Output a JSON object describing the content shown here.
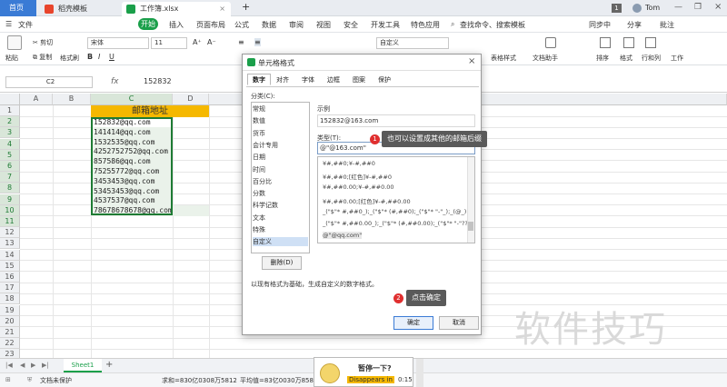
{
  "titlebar": {
    "home": "首页",
    "tab1": "稻壳模板",
    "tab2": "工作簿.xlsx",
    "new_tab": "+",
    "user": "Tom",
    "page_num": "1"
  },
  "menu": {
    "file": "文件",
    "start": "开始",
    "insert": "插入",
    "layout": "页面布局",
    "formula": "公式",
    "data": "数据",
    "review": "审阅",
    "view": "视图",
    "security": "安全",
    "dev": "开发工具",
    "special": "特色应用",
    "search": "查找命令、搜索模板",
    "sync": "同步中",
    "share": "分享",
    "comment": "批注"
  },
  "ribbon": {
    "paste": "粘贴",
    "cut": "剪切",
    "copy": "复制",
    "format_painter": "格式刷",
    "font_name": "宋体",
    "font_size": "11",
    "number_format": "自定义",
    "table_style": "表格样式",
    "doc_helper": "文档助手",
    "sort": "排序",
    "format": "格式",
    "row_col": "行和列",
    "worksheet": "工作"
  },
  "formula_bar": {
    "cell_ref": "C2",
    "fx": "fx",
    "value": "152832"
  },
  "grid": {
    "columns": [
      "A",
      "B",
      "C",
      "D"
    ],
    "rows": [
      "1",
      "2",
      "3",
      "4",
      "5",
      "6",
      "7",
      "8",
      "9",
      "10",
      "11",
      "12",
      "13",
      "14",
      "15",
      "16",
      "17",
      "18",
      "19",
      "20",
      "21",
      "22",
      "23"
    ],
    "header": "邮箱地址",
    "emails": [
      "152832@qq.com",
      "141414@qq.com",
      "1532535@qq.com",
      "4252752752@qq.com",
      "857586@qq.com",
      "75255772@qq.com",
      "3453453@qq.com",
      "53453453@qq.com",
      "4537537@qq.com",
      "78678678678@qq.com"
    ]
  },
  "dialog": {
    "title": "单元格格式",
    "close": "×",
    "tabs": [
      "数字",
      "对齐",
      "字体",
      "边框",
      "图案",
      "保护"
    ],
    "category_label": "分类(C):",
    "categories": [
      "常规",
      "数值",
      "货币",
      "会计专用",
      "日期",
      "时间",
      "百分比",
      "分数",
      "科学记数",
      "文本",
      "特殊",
      "自定义"
    ],
    "sample_label": "示例",
    "sample_value": "152832@163.com",
    "type_label": "类型(T):",
    "type_value": "@\"@163.com\"",
    "formats": [
      "¥#,##0;¥-#,##0",
      "¥#,##0;[红色]¥-#,##0",
      "¥#,##0.00;¥-#,##0.00",
      "¥#,##0.00;[红色]¥-#,##0.00",
      "_(\"$\"* #,##0_);_(\"$\"* (#,##0);_(\"$\"* \"-\"_);_(@_)",
      "_(\"$\"* #,##0.00_);_(\"$\"* (#,##0.00);_(\"$\"* \"-\"??_);_(@_)",
      "@\"@qq.com\""
    ],
    "delete_btn": "删除(D)",
    "description": "以现有格式为基础，生成自定义的数字格式。",
    "ok": "确定",
    "cancel": "取消"
  },
  "callouts": {
    "c1_num": "1",
    "c1_text": "也可以设置成其他的邮箱后缀",
    "c2_num": "2",
    "c2_text": "点击确定"
  },
  "watermark": "软件技巧",
  "sheet": {
    "name": "Sheet1",
    "add": "+"
  },
  "status": {
    "protect": "文档未保护",
    "sum": "求和=830亿0308万5812",
    "avg": "平均值=83亿0030万8581"
  },
  "popup": {
    "title": "暂停一下?",
    "timer_label": "Disappears in",
    "timer": "0:15"
  },
  "colors": {
    "header_fill": "#f5b800",
    "selection": "#1e7b34",
    "accent": "#1a9f4a"
  }
}
